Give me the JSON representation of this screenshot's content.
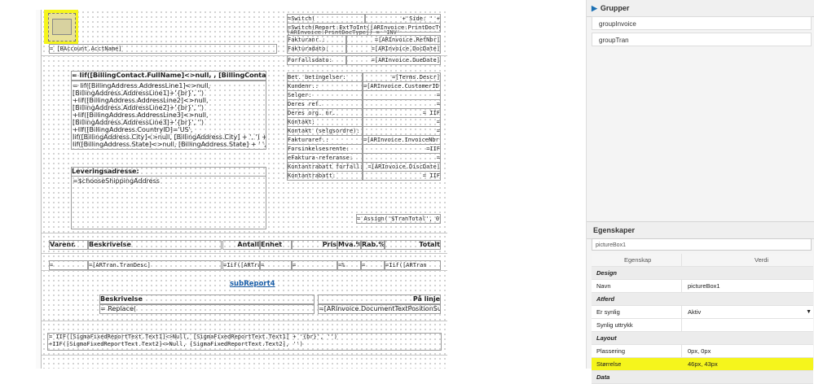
{
  "designer": {
    "account_field": "= [BAccount.AcctName]",
    "billing_name": "= Iif([BillingContact.FullName]<>null, , [BillingContact.FullName], '')",
    "billing_address_lines": [
      "= Iif([BillingAddress.AddressLine1]<>null,",
      "[BillingAddress.AddressLine1]+'{br}', '')",
      "+Iif([BillingAddress.AddressLine2]<>null,",
      "[BillingAddress.AddressLine2]+'{br}', '')",
      "+Iif([BillingAddress.AddressLine3]<>null,",
      "[BillingAddress.AddressLine3]+'{br}', '')",
      "+IIf([BillingAddress.CountryID]='US',",
      "    Iif([BillingAddress.City]<>null, [BillingAddress.City] + ', ') +",
      "Iif([BillingAddress.State]<>null, [BillingAddress.State] + ' ', '') +"
    ],
    "delivery_label": "Leveringsadresse:",
    "delivery_value": "=$chooseShippingAddress",
    "switch_line": "=Switch(",
    "side_label": "+'Side: ' +",
    "switch_line2": "=Switch(Report.ExtToInt([ARInvoice.PrintDocType",
    "switch_line3": "  [ARInvoice.PrintDocType]) = 'INV'",
    "info_rows": [
      {
        "label": "Fakturanr.:",
        "value": "=[ARInvoice.RefNbr]"
      },
      {
        "label": "Fakturadato:",
        "value": "=[ARInvoice.DocDate]"
      },
      {
        "label": "Forfallsdato:",
        "value": "=[ARInvoice.DueDate]"
      }
    ],
    "terms_rows": [
      {
        "label": "Bet. betingelser:",
        "value": "=[Terms.Descr]"
      },
      {
        "label": "Kundenr.:",
        "value": "=[ARInvoice.CustomerID]"
      },
      {
        "label": "Selger:",
        "value": "="
      },
      {
        "label": "Deres ref.",
        "value": "="
      },
      {
        "label": "Deres org. nr.",
        "value": "= IIF"
      },
      {
        "label": "Kontakt:",
        "value": "="
      },
      {
        "label": "Kontakt (selgsordre):",
        "value": "="
      },
      {
        "label": "Fakturaref.:",
        "value": "=[ARInvoice.InvoiceNbr]"
      },
      {
        "label": "Forsinkelsesrente:",
        "value": "=IIF"
      },
      {
        "label": "eFaktura-referanse:",
        "value": "="
      },
      {
        "label": "Kontantrabatt forfall:",
        "value": "=[ARInvoice.DiscDate]"
      },
      {
        "label": "Kontantrabatt:",
        "value": "= IIF"
      }
    ],
    "assign": "= Assign('$TranTotal', 0)",
    "columns": [
      "Varenr.",
      "Beskrivelse",
      "Antall",
      "Enhet",
      "Pris",
      "Mva.%",
      "Rab.%",
      "Totalt"
    ],
    "detail_cells": [
      "=",
      "=[ARTran.TranDesc]",
      "=Iif([ARTran",
      "=",
      "=",
      "=%",
      "=",
      "=Iif([ARTran"
    ],
    "subreport_link": "subReport4",
    "sub_header_desc": "Beskrivelse",
    "sub_header_right": "På linje",
    "sub_replace": "= Replace(",
    "sub_pos": "=[ARInvoice.DocumentTextPositionSummary]",
    "footer_line1": "= IIF([SigmaFixedReportText.Text1]<>Null, [SigmaFixedReportText.Text1] + '{br}', '')",
    "footer_line2": " +IIF([SigmaFixedReportText.Text2]<>Null, [SigmaFixedReportText.Text2], '')",
    "highlight_color": "#f5f51c"
  },
  "panel": {
    "groups_title": "Grupper",
    "groups": [
      "groupInvoice",
      "groupTran"
    ],
    "props_title": "Egenskaper",
    "selected_object": "pictureBox1",
    "col_prop": "Egenskap",
    "col_value": "Verdi",
    "cat_design": "Design",
    "name_label": "Navn",
    "name_value": "pictureBox1",
    "cat_behavior": "Atferd",
    "visible_label": "Er synlig",
    "visible_value": "Aktiv",
    "visible_expr_label": "Synlig uttrykk",
    "cat_layout": "Layout",
    "position_label": "Plassering",
    "position_value": "0px, 0px",
    "size_label": "Størrelse",
    "size_value": "46px, 43px",
    "cat_data": "Data"
  }
}
